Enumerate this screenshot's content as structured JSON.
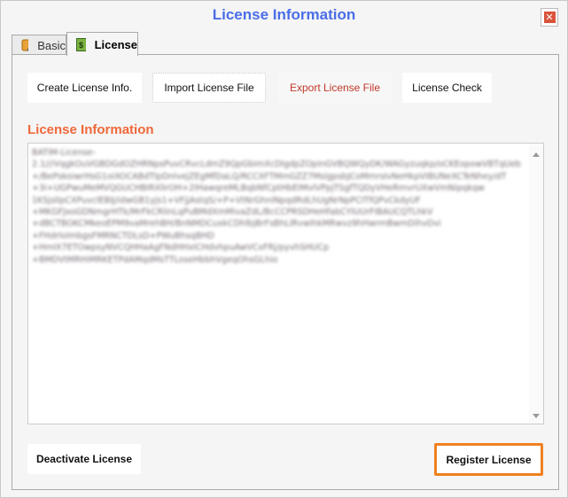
{
  "window": {
    "title": "License Information",
    "close_icon": "close-icon"
  },
  "tabs": [
    {
      "label": "Basic",
      "icon": "database-gear-icon",
      "active": false
    },
    {
      "label": "License",
      "icon": "money-book-icon",
      "active": true
    }
  ],
  "toolbar": {
    "create": "Create License Info.",
    "import": "Import License File",
    "export": "Export License File",
    "check": "License Check"
  },
  "section_title": "License Information",
  "license_text": "BATIM-License-\n2.1///VqgkOuVGBDGdOZHRNpsPuvCRvcLdmZ9QpGbimXcDIgdpZOpinGVBQWQyDK/WAGyzuqkp/oCKEopowVBTqUeb\n+/BePskoiwrHsG1oiXOCABdTIpDnlvejZEgMfDaLQ/RCCXFTMmGZZ7MslgpsbJCoMmrsIvNeHkpVIBUNeXCTeNhey/dT\n+3i+UGPwuMeMVQGUCHBIRXlIrOH+2lHawqreMLBqbNfCptHbEIMvIVPpjTSgfTQDyVHeRmvrUXwVmNipqkqw\n1KSjslIpCXPuvclEBIJ/idwGB1yjs1+VFjjAstqS/+P+VtNrGhnlNpqdRdLhUgNrNpPCITfQPvCkdyUF\n+MKGFJxoGDNmgrHTk/MrFkCRlinLqPuBMdXmMivaZdL/BcCCPRSDHeHfabCYIUUrFIBAUCQTLhkV\n+dBCTBOKCMkeoEPM9vaMrehBH/BnNMDCuxkCDhlbjBrFsBhLlRvwIhkMRwvz9hHwrmBwmDihvDvi\n+FHdrlolmbgsFMRNCTDLsD+PWuBhsqBHD\n+HmIX7ETOwpsyNVCQHHaAgFNdHHxICHdvhpuAwVCxFRj/pyvhSHUCp\n+BMDVtMRHiMRKETPdAMqdMsTTLoseHbbhVgeqOhsGLhio",
  "footer": {
    "deactivate": "Deactivate License",
    "register": "Register License"
  },
  "colors": {
    "title": "#4a6ee8",
    "section": "#f0683a",
    "export_text": "#c0392b",
    "register_border": "#f08020"
  }
}
